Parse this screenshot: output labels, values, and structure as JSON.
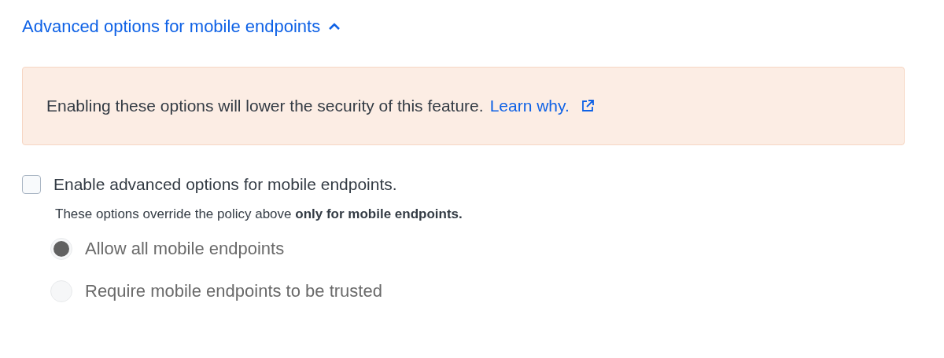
{
  "toggle": {
    "label": "Advanced options for mobile endpoints",
    "expanded": true
  },
  "alert": {
    "text": "Enabling these options will lower the security of this feature.",
    "link": "Learn why."
  },
  "option": {
    "label": "Enable advanced options for mobile endpoints.",
    "checked": false,
    "note": "These options override the policy above **only for mobile endpoints.**"
  },
  "radios": [
    {
      "label": "Allow all mobile endpoints",
      "selected": true,
      "disabled": true
    },
    {
      "label": "Require mobile endpoints to be trusted",
      "selected": false,
      "disabled": true
    }
  ]
}
